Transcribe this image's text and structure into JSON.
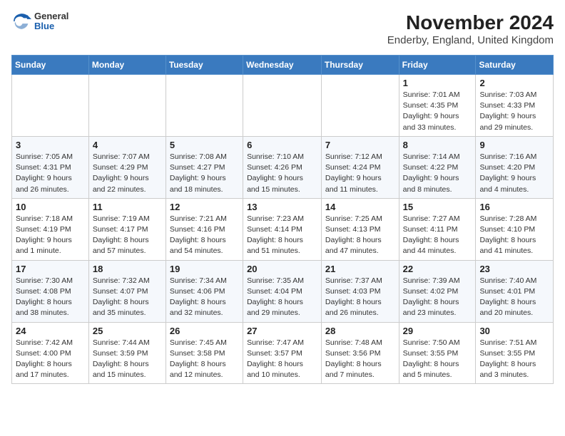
{
  "logo": {
    "general": "General",
    "blue": "Blue"
  },
  "title": "November 2024",
  "subtitle": "Enderby, England, United Kingdom",
  "headers": [
    "Sunday",
    "Monday",
    "Tuesday",
    "Wednesday",
    "Thursday",
    "Friday",
    "Saturday"
  ],
  "rows": [
    [
      {
        "day": "",
        "detail": ""
      },
      {
        "day": "",
        "detail": ""
      },
      {
        "day": "",
        "detail": ""
      },
      {
        "day": "",
        "detail": ""
      },
      {
        "day": "",
        "detail": ""
      },
      {
        "day": "1",
        "detail": "Sunrise: 7:01 AM\nSunset: 4:35 PM\nDaylight: 9 hours\nand 33 minutes."
      },
      {
        "day": "2",
        "detail": "Sunrise: 7:03 AM\nSunset: 4:33 PM\nDaylight: 9 hours\nand 29 minutes."
      }
    ],
    [
      {
        "day": "3",
        "detail": "Sunrise: 7:05 AM\nSunset: 4:31 PM\nDaylight: 9 hours\nand 26 minutes."
      },
      {
        "day": "4",
        "detail": "Sunrise: 7:07 AM\nSunset: 4:29 PM\nDaylight: 9 hours\nand 22 minutes."
      },
      {
        "day": "5",
        "detail": "Sunrise: 7:08 AM\nSunset: 4:27 PM\nDaylight: 9 hours\nand 18 minutes."
      },
      {
        "day": "6",
        "detail": "Sunrise: 7:10 AM\nSunset: 4:26 PM\nDaylight: 9 hours\nand 15 minutes."
      },
      {
        "day": "7",
        "detail": "Sunrise: 7:12 AM\nSunset: 4:24 PM\nDaylight: 9 hours\nand 11 minutes."
      },
      {
        "day": "8",
        "detail": "Sunrise: 7:14 AM\nSunset: 4:22 PM\nDaylight: 9 hours\nand 8 minutes."
      },
      {
        "day": "9",
        "detail": "Sunrise: 7:16 AM\nSunset: 4:20 PM\nDaylight: 9 hours\nand 4 minutes."
      }
    ],
    [
      {
        "day": "10",
        "detail": "Sunrise: 7:18 AM\nSunset: 4:19 PM\nDaylight: 9 hours\nand 1 minute."
      },
      {
        "day": "11",
        "detail": "Sunrise: 7:19 AM\nSunset: 4:17 PM\nDaylight: 8 hours\nand 57 minutes."
      },
      {
        "day": "12",
        "detail": "Sunrise: 7:21 AM\nSunset: 4:16 PM\nDaylight: 8 hours\nand 54 minutes."
      },
      {
        "day": "13",
        "detail": "Sunrise: 7:23 AM\nSunset: 4:14 PM\nDaylight: 8 hours\nand 51 minutes."
      },
      {
        "day": "14",
        "detail": "Sunrise: 7:25 AM\nSunset: 4:13 PM\nDaylight: 8 hours\nand 47 minutes."
      },
      {
        "day": "15",
        "detail": "Sunrise: 7:27 AM\nSunset: 4:11 PM\nDaylight: 8 hours\nand 44 minutes."
      },
      {
        "day": "16",
        "detail": "Sunrise: 7:28 AM\nSunset: 4:10 PM\nDaylight: 8 hours\nand 41 minutes."
      }
    ],
    [
      {
        "day": "17",
        "detail": "Sunrise: 7:30 AM\nSunset: 4:08 PM\nDaylight: 8 hours\nand 38 minutes."
      },
      {
        "day": "18",
        "detail": "Sunrise: 7:32 AM\nSunset: 4:07 PM\nDaylight: 8 hours\nand 35 minutes."
      },
      {
        "day": "19",
        "detail": "Sunrise: 7:34 AM\nSunset: 4:06 PM\nDaylight: 8 hours\nand 32 minutes."
      },
      {
        "day": "20",
        "detail": "Sunrise: 7:35 AM\nSunset: 4:04 PM\nDaylight: 8 hours\nand 29 minutes."
      },
      {
        "day": "21",
        "detail": "Sunrise: 7:37 AM\nSunset: 4:03 PM\nDaylight: 8 hours\nand 26 minutes."
      },
      {
        "day": "22",
        "detail": "Sunrise: 7:39 AM\nSunset: 4:02 PM\nDaylight: 8 hours\nand 23 minutes."
      },
      {
        "day": "23",
        "detail": "Sunrise: 7:40 AM\nSunset: 4:01 PM\nDaylight: 8 hours\nand 20 minutes."
      }
    ],
    [
      {
        "day": "24",
        "detail": "Sunrise: 7:42 AM\nSunset: 4:00 PM\nDaylight: 8 hours\nand 17 minutes."
      },
      {
        "day": "25",
        "detail": "Sunrise: 7:44 AM\nSunset: 3:59 PM\nDaylight: 8 hours\nand 15 minutes."
      },
      {
        "day": "26",
        "detail": "Sunrise: 7:45 AM\nSunset: 3:58 PM\nDaylight: 8 hours\nand 12 minutes."
      },
      {
        "day": "27",
        "detail": "Sunrise: 7:47 AM\nSunset: 3:57 PM\nDaylight: 8 hours\nand 10 minutes."
      },
      {
        "day": "28",
        "detail": "Sunrise: 7:48 AM\nSunset: 3:56 PM\nDaylight: 8 hours\nand 7 minutes."
      },
      {
        "day": "29",
        "detail": "Sunrise: 7:50 AM\nSunset: 3:55 PM\nDaylight: 8 hours\nand 5 minutes."
      },
      {
        "day": "30",
        "detail": "Sunrise: 7:51 AM\nSunset: 3:55 PM\nDaylight: 8 hours\nand 3 minutes."
      }
    ]
  ]
}
